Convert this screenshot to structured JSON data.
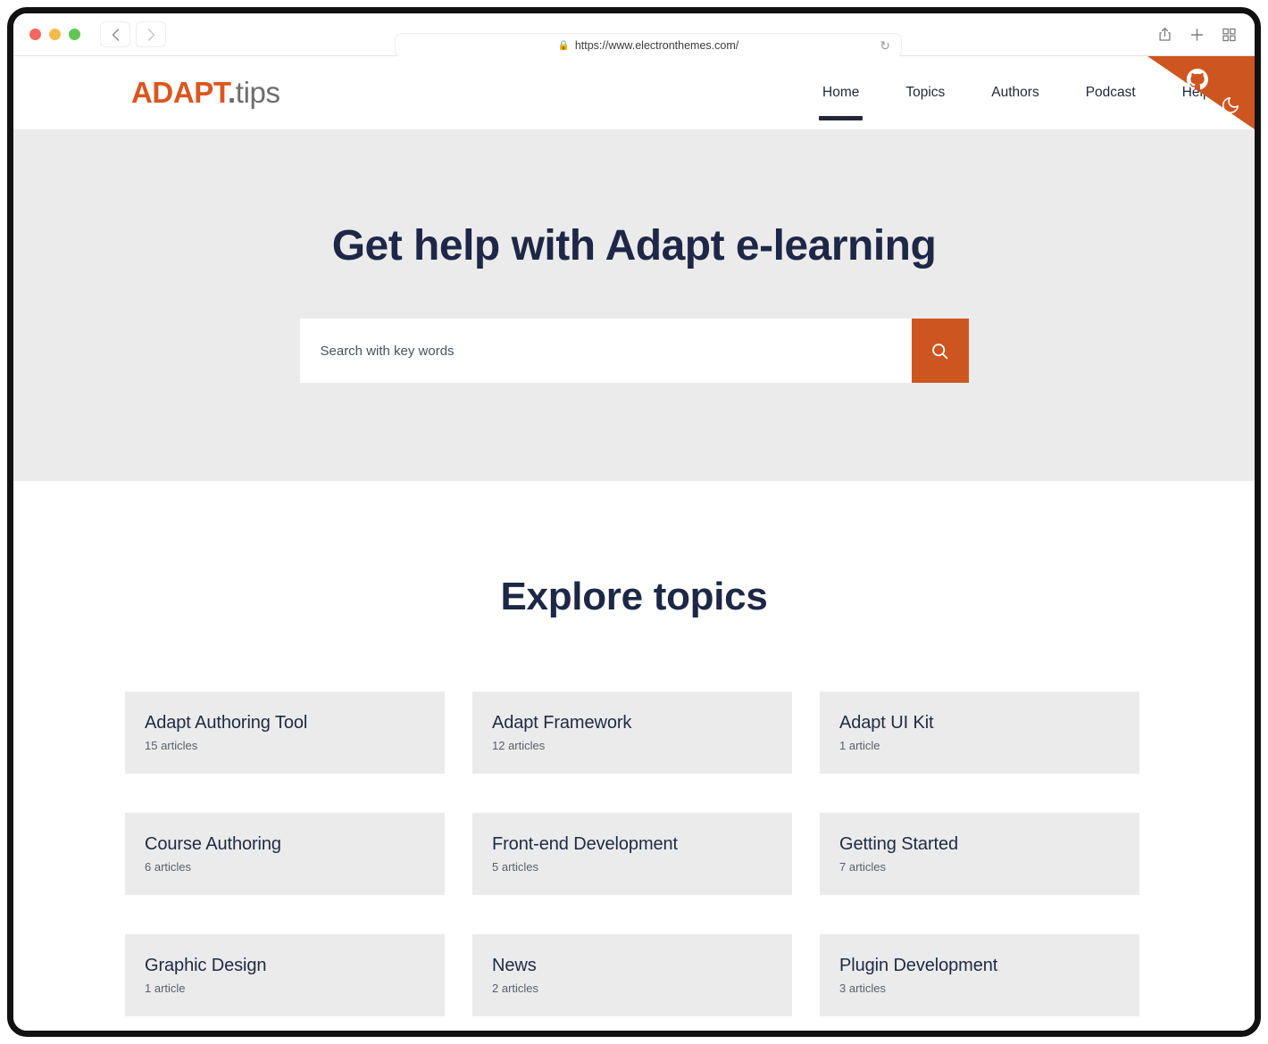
{
  "browser": {
    "url": "https://www.electronthemes.com/",
    "lock_icon": "lock-icon",
    "reload_icon": "reload-icon",
    "back_icon": "chevron-left-icon",
    "forward_icon": "chevron-right-icon",
    "share_icon": "share-icon",
    "new_tab_icon": "plus-icon",
    "tab_overview_icon": "grid-icon"
  },
  "site": {
    "logo": {
      "brand": "ADAPT",
      "dot": ".",
      "suffix": "tips"
    },
    "nav": [
      {
        "label": "Home",
        "active": true
      },
      {
        "label": "Topics",
        "active": false
      },
      {
        "label": "Authors",
        "active": false
      },
      {
        "label": "Podcast",
        "active": false
      },
      {
        "label": "Help",
        "active": false
      }
    ],
    "github_icon": "github-icon",
    "dark_mode_icon": "moon-icon"
  },
  "hero": {
    "title": "Get help with Adapt e-learning",
    "search": {
      "placeholder": "Search with key words",
      "value": "",
      "button_icon": "search-icon"
    }
  },
  "topics": {
    "heading": "Explore topics",
    "cards": [
      {
        "title": "Adapt Authoring Tool",
        "count": "15 articles"
      },
      {
        "title": "Adapt Framework",
        "count": "12 articles"
      },
      {
        "title": "Adapt UI Kit",
        "count": "1 article"
      },
      {
        "title": "Course Authoring",
        "count": "6 articles"
      },
      {
        "title": "Front-end Development",
        "count": "5 articles"
      },
      {
        "title": "Getting Started",
        "count": "7 articles"
      },
      {
        "title": "Graphic Design",
        "count": "1 article"
      },
      {
        "title": "News",
        "count": "2 articles"
      },
      {
        "title": "Plugin Development",
        "count": "3 articles"
      }
    ]
  },
  "colors": {
    "accent_orange": "#cd5620",
    "heading_navy": "#1e2747",
    "hero_bg": "#ebebeb",
    "card_bg": "#ebebeb"
  }
}
